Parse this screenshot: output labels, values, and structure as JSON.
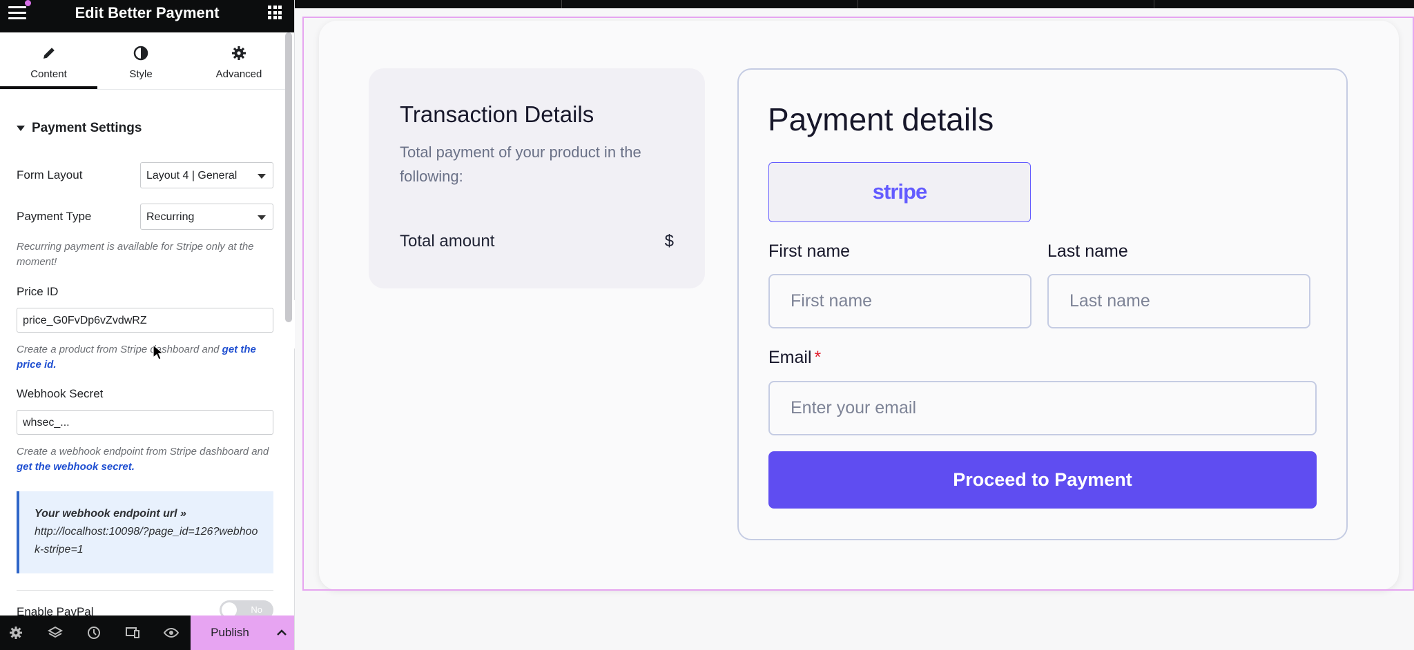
{
  "editor": {
    "title": "Edit Better Payment",
    "tabs": [
      {
        "label": "Content",
        "icon": "pencil-icon"
      },
      {
        "label": "Style",
        "icon": "half-circle-icon"
      },
      {
        "label": "Advanced",
        "icon": "gear-icon"
      }
    ],
    "section_title": "Payment Settings",
    "form_layout": {
      "label": "Form Layout",
      "value": "Layout 4 | General"
    },
    "payment_type": {
      "label": "Payment Type",
      "value": "Recurring"
    },
    "recurring_note": "Recurring payment is available for Stripe only at the moment!",
    "price_id": {
      "label": "Price ID",
      "value": "price_G0FvDp6vZvdwRZ"
    },
    "price_note": "Create a product from Stripe dashboard and ",
    "price_link": "get the price id.",
    "webhook_secret": {
      "label": "Webhook Secret",
      "value": "whsec_..."
    },
    "webhook_note": "Create a webhook endpoint from Stripe dashboard and ",
    "webhook_link": "get the webhook secret.",
    "webhook_box_head": "Your webhook endpoint url »",
    "webhook_box_url": "http://localhost:10098/?page_id=126?webhook-stripe=1",
    "enable_paypal": {
      "label": "Enable PayPal",
      "toggle": "No"
    },
    "footer": {
      "publish": "Publish"
    }
  },
  "preview": {
    "transaction": {
      "title": "Transaction Details",
      "description": "Total payment of your product in the following:",
      "total_label": "Total amount",
      "currency": "$"
    },
    "payment": {
      "title": "Payment details",
      "stripe_logo": "stripe",
      "first_name_label": "First name",
      "first_name_placeholder": "First name",
      "last_name_label": "Last name",
      "last_name_placeholder": "Last name",
      "email_label": "Email",
      "email_required": "*",
      "email_placeholder": "Enter your email",
      "submit": "Proceed to Payment"
    }
  },
  "colors": {
    "accent": "#5f4df1",
    "stripe": "#635bff",
    "publish": "#e7a4f2",
    "link": "#1f4fd1"
  }
}
